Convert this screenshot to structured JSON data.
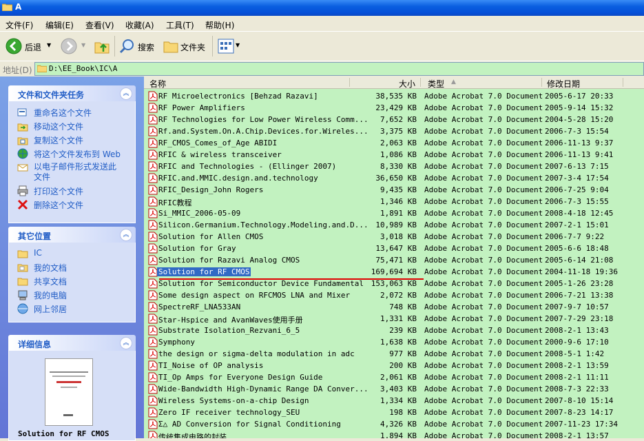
{
  "window": {
    "title": "A"
  },
  "menu": [
    "文件(F)",
    "编辑(E)",
    "查看(V)",
    "收藏(A)",
    "工具(T)",
    "帮助(H)"
  ],
  "toolbar": {
    "back": "后退",
    "search": "搜索",
    "folders": "文件夹"
  },
  "address": {
    "label": "地址(D)",
    "path": "D:\\EE_Book\\IC\\A"
  },
  "tasks": {
    "title": "文件和文件夹任务",
    "items": [
      "重命名这个文件",
      "移动这个文件",
      "复制这个文件",
      "将这个文件发布到 Web",
      "以电子邮件形式发送此文件",
      "打印这个文件",
      "删除这个文件"
    ]
  },
  "places": {
    "title": "其它位置",
    "items": [
      "IC",
      "我的文档",
      "共享文档",
      "我的电脑",
      "网上邻居"
    ]
  },
  "details": {
    "title": "详细信息",
    "filename": "Solution for RF CMOS"
  },
  "columns": {
    "name": "名称",
    "size": "大小",
    "type": "类型",
    "date": "修改日期"
  },
  "files": [
    {
      "name": "RF Microelectronics [Behzad Razavi]",
      "size": "38,535 KB",
      "type": "Adobe Acrobat 7.0 Document",
      "date": "2005-6-17 20:33"
    },
    {
      "name": "RF Power Amplifiers",
      "size": "23,429 KB",
      "type": "Adobe Acrobat 7.0 Document",
      "date": "2005-9-14 15:32"
    },
    {
      "name": "RF Technologies for Low Power Wireless Comm...",
      "size": "7,652 KB",
      "type": "Adobe Acrobat 7.0 Document",
      "date": "2004-5-28 15:20"
    },
    {
      "name": "Rf.and.System.On.A.Chip.Devices.for.Wireles...",
      "size": "3,375 KB",
      "type": "Adobe Acrobat 7.0 Document",
      "date": "2006-7-3 15:54"
    },
    {
      "name": "RF_CMOS_Comes_of_Age ABIDI",
      "size": "2,063 KB",
      "type": "Adobe Acrobat 7.0 Document",
      "date": "2006-11-13 9:37"
    },
    {
      "name": "RFIC & wireless transceiver",
      "size": "1,086 KB",
      "type": "Adobe Acrobat 7.0 Document",
      "date": "2006-11-13 9:41"
    },
    {
      "name": "RFIC and Technologies - (Ellinger 2007)",
      "size": "8,330 KB",
      "type": "Adobe Acrobat 7.0 Document",
      "date": "2007-6-13 7:15"
    },
    {
      "name": "RFIC.and.MMIC.design.and.technology",
      "size": "36,650 KB",
      "type": "Adobe Acrobat 7.0 Document",
      "date": "2007-3-4 17:54"
    },
    {
      "name": "RFIC_Design_John Rogers",
      "size": "9,435 KB",
      "type": "Adobe Acrobat 7.0 Document",
      "date": "2006-7-25 9:04"
    },
    {
      "name": "RFIC教程",
      "size": "1,346 KB",
      "type": "Adobe Acrobat 7.0 Document",
      "date": "2006-7-3 15:55"
    },
    {
      "name": "Si_MMIC_2006-05-09",
      "size": "1,891 KB",
      "type": "Adobe Acrobat 7.0 Document",
      "date": "2008-4-18 12:45"
    },
    {
      "name": "Silicon.Germanium.Technology.Modeling.and.D...",
      "size": "10,989 KB",
      "type": "Adobe Acrobat 7.0 Document",
      "date": "2007-2-1 15:01"
    },
    {
      "name": "Solution for Allen CMOS",
      "size": "3,018 KB",
      "type": "Adobe Acrobat 7.0 Document",
      "date": "2006-7-7 9:22"
    },
    {
      "name": "Solution for Gray",
      "size": "13,647 KB",
      "type": "Adobe Acrobat 7.0 Document",
      "date": "2005-6-6 18:48"
    },
    {
      "name": "Solution for Razavi Analog CMOS",
      "size": "75,471 KB",
      "type": "Adobe Acrobat 7.0 Document",
      "date": "2005-6-14 21:08"
    },
    {
      "name": "Solution for RF CMOS",
      "size": "169,694 KB",
      "type": "Adobe Acrobat 7.0 Document",
      "date": "2004-11-18 19:36"
    },
    {
      "name": "Solution for Semiconductor Device Fundamental",
      "size": "153,063 KB",
      "type": "Adobe Acrobat 7.0 Document",
      "date": "2005-1-26 23:28"
    },
    {
      "name": "Some design aspect on RFCMOS LNA and Mixer",
      "size": "2,072 KB",
      "type": "Adobe Acrobat 7.0 Document",
      "date": "2006-7-21 13:38"
    },
    {
      "name": "SpectreRF_LNA533AN",
      "size": "748 KB",
      "type": "Adobe Acrobat 7.0 Document",
      "date": "2007-9-7 10:57"
    },
    {
      "name": "Star-Hspice and AvanWaves使用手册",
      "size": "1,331 KB",
      "type": "Adobe Acrobat 7.0 Document",
      "date": "2007-7-29 23:18"
    },
    {
      "name": "Substrate Isolation_Rezvani_6_5",
      "size": "239 KB",
      "type": "Adobe Acrobat 7.0 Document",
      "date": "2008-2-1 13:43"
    },
    {
      "name": "Symphony",
      "size": "1,638 KB",
      "type": "Adobe Acrobat 7.0 Document",
      "date": "2000-9-6 17:10"
    },
    {
      "name": "the design or sigma-delta modulation in adc",
      "size": "977 KB",
      "type": "Adobe Acrobat 7.0 Document",
      "date": "2008-5-1 1:42"
    },
    {
      "name": "TI_Noise of OP analysis",
      "size": "200 KB",
      "type": "Adobe Acrobat 7.0 Document",
      "date": "2008-2-1 13:59"
    },
    {
      "name": "TI_Op Amps for Everyone Design Guide",
      "size": "2,061 KB",
      "type": "Adobe Acrobat 7.0 Document",
      "date": "2008-2-1 11:11"
    },
    {
      "name": "Wide-Bandwidth High-Dynamic Range DA Conver...",
      "size": "3,403 KB",
      "type": "Adobe Acrobat 7.0 Document",
      "date": "2008-7-3 22:33"
    },
    {
      "name": "Wireless Systems-on-a-chip Design",
      "size": "1,334 KB",
      "type": "Adobe Acrobat 7.0 Document",
      "date": "2007-8-10 15:14"
    },
    {
      "name": "Zero IF receiver technology_SEU",
      "size": "198 KB",
      "type": "Adobe Acrobat 7.0 Document",
      "date": "2007-8-23 14:17"
    },
    {
      "name": "Σ△ AD Conversion for Signal Conditioning",
      "size": "4,326 KB",
      "type": "Adobe Acrobat 7.0 Document",
      "date": "2007-11-23 17:34"
    },
    {
      "name": "传统集成电路的封装",
      "size": "1,894 KB",
      "type": "Adobe Acrobat 7.0 Document",
      "date": "2008-2-1 13:57"
    }
  ],
  "selected_index": 15,
  "colors": {
    "list_bg": "#c2f2c0",
    "selection": "#316ac5",
    "annotation": "#e00000",
    "task_link": "#215dc6"
  }
}
